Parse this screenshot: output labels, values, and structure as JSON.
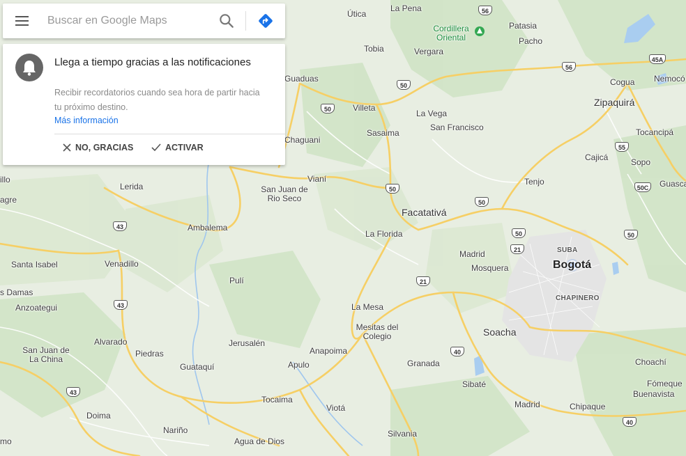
{
  "search": {
    "placeholder": "Buscar en Google Maps",
    "menu_icon": "hamburger-menu-icon",
    "search_icon": "search-icon",
    "directions_icon": "directions-icon",
    "accent_color": "#1a73e8"
  },
  "notification": {
    "icon": "bell-icon",
    "title": "Llega a tiempo gracias a las notificaciones",
    "body": "Recibir recordatorios cuando sea hora de partir hacia tu próximo destino.",
    "link": "Más información",
    "dismiss_label": "NO, GRACIAS",
    "activate_label": "ACTIVAR"
  },
  "map": {
    "places": {
      "utica": "Útica",
      "la_pena": "La Pena",
      "patasia": "Patasia",
      "pacho": "Pacho",
      "cordillera": "Cordillera\nOriental",
      "tobia": "Tobia",
      "vergara": "Vergara",
      "guaduas": "Guaduas",
      "cogua": "Cogua",
      "nemocon": "Nemocó",
      "villeta": "Villeta",
      "la_vega": "La Vega",
      "zipaquira": "Zipaquirá",
      "san_francisco": "San Francisco",
      "sasaima": "Sasaima",
      "chaguani": "Chaguani",
      "tocancipa": "Tocancipá",
      "cajica": "Cajicá",
      "sopo": "Sopo",
      "illo": "illo",
      "vianí": "Vianí",
      "lerida": "Lerida",
      "san_juan_rio_seco": "San Juan de\nRio Seco",
      "tenjo": "Tenjo",
      "guasca": "Guasca",
      "agre": "agre",
      "facatativa": "Facatativá",
      "ambalema": "Ambalema",
      "la_florida": "La Florida",
      "suba": "SUBA",
      "madrid": "Madrid",
      "bogota": "Bogotá",
      "santa_isabel": "Santa Isabel",
      "venadillo": "Venadillo",
      "mosquera": "Mosquera",
      "puli": "Pulí",
      "s_damas": "s Damas",
      "chapinero": "CHAPINERO",
      "anzoategui": "Anzoategui",
      "la_mesa": "La Mesa",
      "mesitas": "Mesitas del\nColegio",
      "soacha": "Soacha",
      "alvarado": "Alvarado",
      "jerusalen": "Jerusalén",
      "san_juan_china": "San Juan de\nLa China",
      "piedras": "Piedras",
      "anapoima": "Anapoima",
      "apulo": "Apulo",
      "granada": "Granada",
      "guataqui": "Guataquí",
      "choachi": "Choachí",
      "sibate": "Sibaté",
      "fomeque": "Fómeque",
      "buenavista": "Buenavista",
      "tocaima": "Tocaima",
      "viota": "Viotá",
      "madrid2": "Madrid",
      "chipaque": "Chipaque",
      "doima": "Doima",
      "narino": "Nariño",
      "silvania": "Silvania",
      "mo": "mo",
      "agua_de_dios": "Agua de Dios"
    },
    "shields": [
      "56",
      "50",
      "50",
      "56",
      "45A",
      "55",
      "50C",
      "50",
      "50",
      "43",
      "50",
      "21",
      "21",
      "43",
      "40",
      "43",
      "40",
      "50"
    ]
  }
}
